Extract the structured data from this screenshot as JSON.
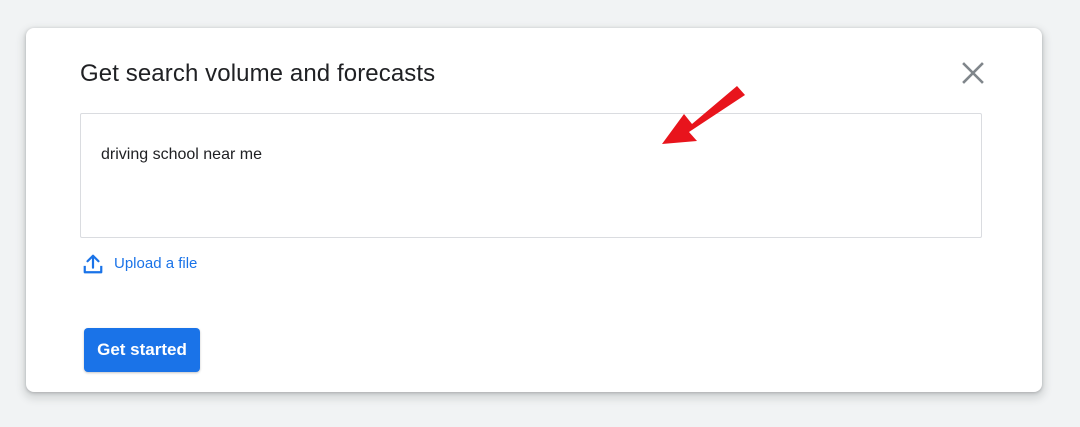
{
  "dialog": {
    "title": "Get search volume and forecasts",
    "close_icon": "close-icon",
    "keyword_input": {
      "value": "driving school near me"
    },
    "upload": {
      "icon": "upload-icon",
      "label": "Upload a file"
    },
    "primary_button": {
      "label": "Get started"
    }
  },
  "annotation": {
    "type": "arrow",
    "color": "#e8141c"
  },
  "colors": {
    "background": "#f1f3f4",
    "accent": "#1a73e8",
    "title_text": "#202124",
    "border": "#dadce0"
  }
}
